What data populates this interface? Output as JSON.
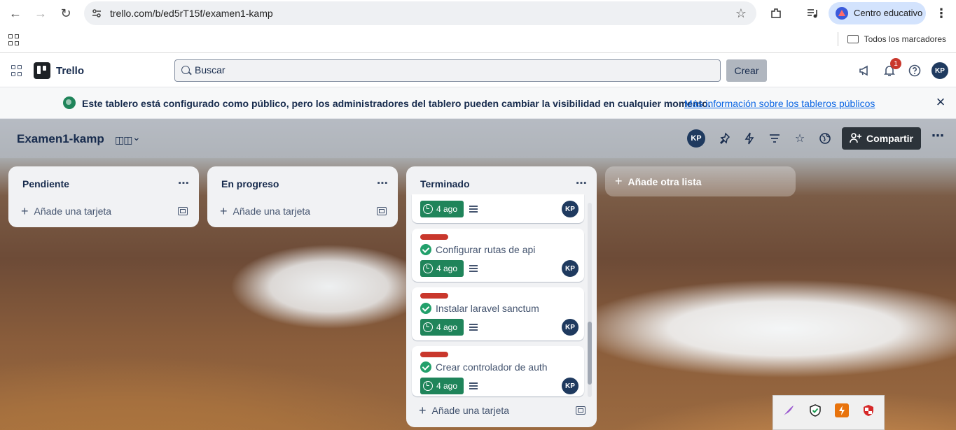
{
  "browser": {
    "url": "trello.com/b/ed5rT15f/examen1-kamp",
    "profile_label": "Centro educativo",
    "bookmarks_label": "Todos los marcadores"
  },
  "header": {
    "brand": "Trello",
    "search_placeholder": "Buscar",
    "create_label": "Crear",
    "notification_count": "1",
    "user_initials": "KP"
  },
  "banner": {
    "text": "Este tablero está configurado como público, pero los administradores del tablero pueden cambiar la visibilidad en cualquier momento.",
    "link": "Más información sobre los tableros públicos"
  },
  "board": {
    "title": "Examen1-kamp",
    "member_initials": "KP",
    "share_label": "Compartir",
    "add_list_label": "Añade otra lista"
  },
  "lists": [
    {
      "title": "Pendiente",
      "add_card_label": "Añade una tarjeta"
    },
    {
      "title": "En progreso",
      "add_card_label": "Añade una tarjeta"
    },
    {
      "title": "Terminado",
      "add_card_label": "Añade una tarjeta",
      "cards": [
        {
          "title": "",
          "due": "4 ago",
          "member": "KP"
        },
        {
          "title": "Configurar rutas de api",
          "due": "4 ago",
          "member": "KP"
        },
        {
          "title": "Instalar laravel sanctum",
          "due": "4 ago",
          "member": "KP"
        },
        {
          "title": "Crear controlador de auth",
          "due": "4 ago",
          "member": "KP"
        }
      ]
    }
  ],
  "colors": {
    "label_red": "#c9372c",
    "due_green": "#1f845a",
    "link_blue": "#0c66e4"
  }
}
